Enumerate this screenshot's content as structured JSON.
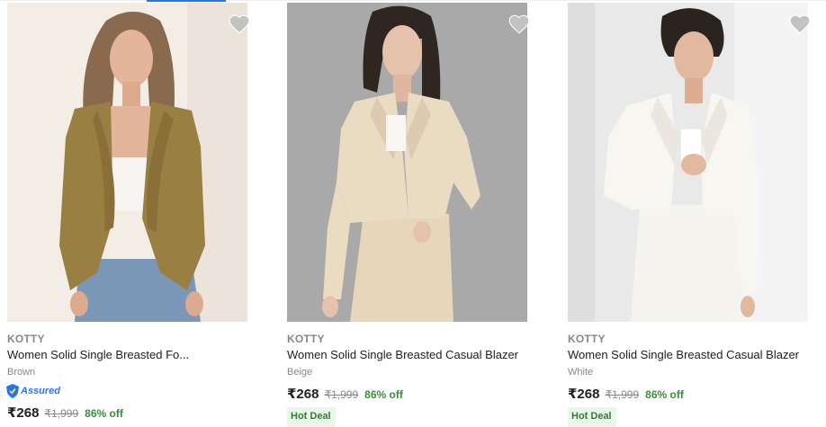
{
  "colors": {
    "accent": "#2874f0",
    "discount": "#388e3c",
    "hot_deal_bg": "#e9f7ea",
    "muted": "#878787"
  },
  "products": [
    {
      "brand": "KOTTY",
      "title": "Women Solid Single Breasted Fo...",
      "color": "Brown",
      "assured_label": "Assured",
      "price": "₹268",
      "mrp": "₹1,999",
      "discount": "86% off",
      "image": "woman-in-brown-blazer",
      "wishlist_icon": "heart-icon"
    },
    {
      "brand": "KOTTY",
      "title": "Women Solid Single Breasted Casual Blazer",
      "color": "Beige",
      "price": "₹268",
      "mrp": "₹1,999",
      "discount": "86% off",
      "badge": "Hot Deal",
      "image": "woman-in-beige-blazer",
      "wishlist_icon": "heart-icon"
    },
    {
      "brand": "KOTTY",
      "title": "Women Solid Single Breasted Casual Blazer",
      "color": "White",
      "price": "₹268",
      "mrp": "₹1,999",
      "discount": "86% off",
      "badge": "Hot Deal",
      "image": "woman-in-white-blazer",
      "wishlist_icon": "heart-icon"
    }
  ]
}
